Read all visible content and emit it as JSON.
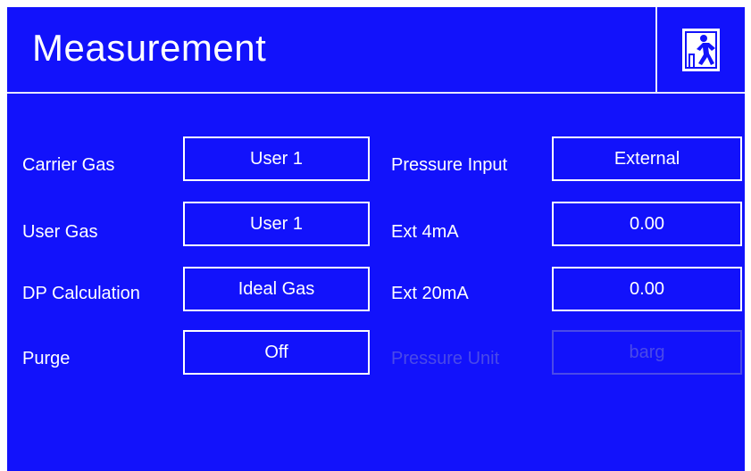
{
  "header": {
    "title": "Measurement",
    "exit_icon": "exit-door-running-person-icon"
  },
  "colors": {
    "background": "#1212fb",
    "foreground": "#ffffff",
    "disabled": "#4a4ae8"
  },
  "left_settings": [
    {
      "label": "Carrier Gas",
      "value": "User 1"
    },
    {
      "label": "User Gas",
      "value": "User 1"
    },
    {
      "label": "DP Calculation",
      "value": "Ideal Gas"
    },
    {
      "label": "Purge",
      "value": "Off"
    }
  ],
  "right_settings": [
    {
      "label": "Pressure Input",
      "value": "External",
      "enabled": true
    },
    {
      "label": "Ext 4mA",
      "value": "0.00",
      "enabled": true
    },
    {
      "label": "Ext 20mA",
      "value": "0.00",
      "enabled": true
    },
    {
      "label": "Pressure Unit",
      "value": "barg",
      "enabled": false
    }
  ]
}
